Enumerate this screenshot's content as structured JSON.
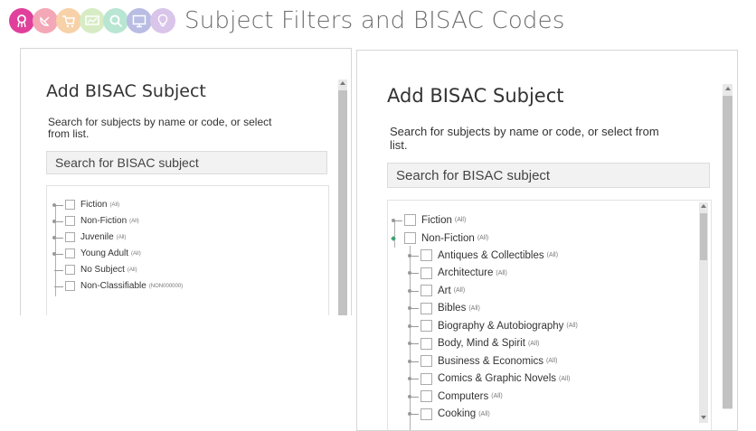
{
  "header": {
    "title": "Subject Filters and BISAC Codes",
    "icons": [
      {
        "name": "award-ribbon-icon",
        "color": "#e0409b"
      },
      {
        "name": "satellite-dish-icon",
        "color": "#f4a7b6"
      },
      {
        "name": "shopping-cart-icon",
        "color": "#f7d1a8"
      },
      {
        "name": "chart-board-icon",
        "color": "#d7ecc4"
      },
      {
        "name": "magnifier-icon",
        "color": "#b8e6d3"
      },
      {
        "name": "monitor-icon",
        "color": "#b9bde3"
      },
      {
        "name": "lightbulb-icon",
        "color": "#d9c4ea"
      }
    ]
  },
  "panel_small": {
    "title": "Add BISAC Subject",
    "description": "Search for subjects by name or code, or select from list.",
    "search_placeholder": "Search for BISAC subject",
    "items": [
      {
        "label": "Fiction",
        "tag": "(All)"
      },
      {
        "label": "Non-Fiction",
        "tag": "(All)"
      },
      {
        "label": "Juvenile",
        "tag": "(All)"
      },
      {
        "label": "Young Adult",
        "tag": "(All)"
      },
      {
        "label": "No Subject",
        "tag": "(All)"
      },
      {
        "label": "Non-Classifiable",
        "tag": "(NON000000)"
      }
    ]
  },
  "panel_large": {
    "title": "Add BISAC Subject",
    "description": "Search for subjects by name or code, or select from list.",
    "search_placeholder": "Search for BISAC subject",
    "items": [
      {
        "label": "Fiction",
        "tag": "(All)"
      },
      {
        "label": "Non-Fiction",
        "tag": "(All)"
      }
    ],
    "children": [
      {
        "label": "Antiques & Collectibles",
        "tag": "(All)"
      },
      {
        "label": "Architecture",
        "tag": "(All)"
      },
      {
        "label": "Art",
        "tag": "(All)"
      },
      {
        "label": "Bibles",
        "tag": "(All)"
      },
      {
        "label": "Biography & Autobiography",
        "tag": "(All)"
      },
      {
        "label": "Body, Mind & Spirit",
        "tag": "(All)"
      },
      {
        "label": "Business & Economics",
        "tag": "(All)"
      },
      {
        "label": "Comics & Graphic Novels",
        "tag": "(All)"
      },
      {
        "label": "Computers",
        "tag": "(All)"
      },
      {
        "label": "Cooking",
        "tag": "(All)"
      }
    ]
  },
  "colors": {
    "expanded_marker": "#3aa36f",
    "title_gray": "#6d6d6d"
  }
}
